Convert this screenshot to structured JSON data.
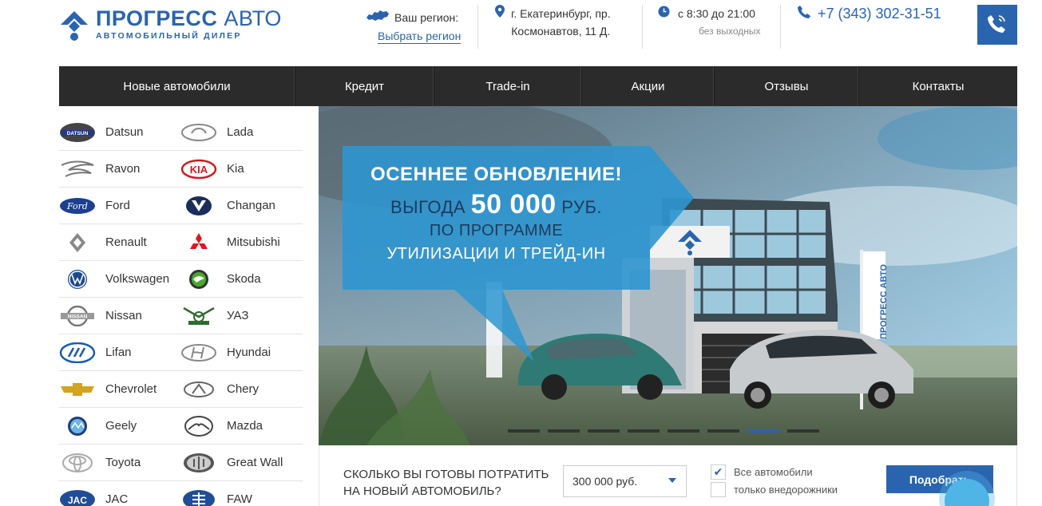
{
  "header": {
    "logo_title_bold": "ПРОГРЕСС",
    "logo_title_thin": "АВТО",
    "logo_subtitle": "АВТОМОБИЛЬНЫЙ ДИЛЕР",
    "region_label": "Ваш регион:",
    "region_link": "Выбрать регион",
    "address_line1": "г. Екатеринбург, пр.",
    "address_line2": "Космонавтов, 11 Д.",
    "hours": "с 8:30 до 21:00",
    "hours_note": "без выходных",
    "phone": "+7 (343) 302-31-51"
  },
  "nav": [
    {
      "label": "Новые автомобили"
    },
    {
      "label": "Кредит"
    },
    {
      "label": "Trade-in"
    },
    {
      "label": "Акции"
    },
    {
      "label": "Отзывы"
    },
    {
      "label": "Контакты"
    }
  ],
  "brands": [
    [
      "Datsun",
      "Lada"
    ],
    [
      "Ravon",
      "Kia"
    ],
    [
      "Ford",
      "Changan"
    ],
    [
      "Renault",
      "Mitsubishi"
    ],
    [
      "Volkswagen",
      "Skoda"
    ],
    [
      "Nissan",
      "УАЗ"
    ],
    [
      "Lifan",
      "Hyundai"
    ],
    [
      "Chevrolet",
      "Chery"
    ],
    [
      "Geely",
      "Mazda"
    ],
    [
      "Toyota",
      "Great Wall"
    ],
    [
      "JAC",
      "FAW"
    ]
  ],
  "brand_logo_text": {
    "datsun": "DATSUN",
    "kia": "KIA",
    "ford": "Ford",
    "nissan": "NISSAN",
    "jac": "JAC"
  },
  "banner": {
    "line1": "ОСЕННЕЕ ОБНОВЛЕНИЕ!",
    "line2_pre": "ВЫГОДА",
    "line2_big": "50 000",
    "line2_post": "РУБ.",
    "line3": "ПО ПРОГРАММЕ",
    "line4": "УТИЛИЗАЦИИ И ТРЕЙД-ИН",
    "flag_text": "ПРОГРЕСС АВТО",
    "slides_total": 8,
    "active_slide": 7
  },
  "filter": {
    "question_line1": "СКОЛЬКО ВЫ ГОТОВЫ ПОТРАТИТЬ",
    "question_line2": "НА НОВЫЙ АВТОМОБИЛЬ?",
    "budget_value": "300 000 руб.",
    "option_all": "Все автомобили",
    "option_all_checked": true,
    "option_suv": "только внедорожники",
    "option_suv_checked": false,
    "submit": "Подобрать"
  },
  "colors": {
    "brand_blue": "#2a64ae",
    "nav_bg": "#2b2b2b",
    "promo_blue": "#2e96d0"
  }
}
